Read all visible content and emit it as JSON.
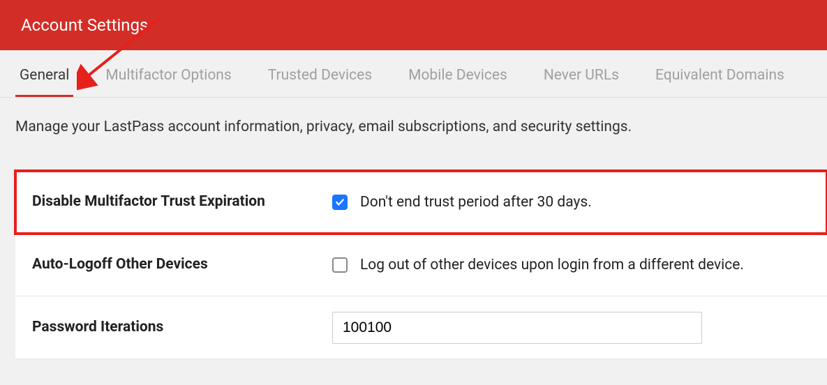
{
  "header": {
    "title": "Account Settings"
  },
  "tabs": [
    {
      "label": "General",
      "active": true
    },
    {
      "label": "Multifactor Options",
      "active": false
    },
    {
      "label": "Trusted Devices",
      "active": false
    },
    {
      "label": "Mobile Devices",
      "active": false
    },
    {
      "label": "Never URLs",
      "active": false
    },
    {
      "label": "Equivalent Domains",
      "active": false
    }
  ],
  "description": "Manage your LastPass account information, privacy, email subscriptions, and security settings.",
  "settings": {
    "multifactorTrust": {
      "label": "Disable Multifactor Trust Expiration",
      "checkboxLabel": "Don't end trust period after 30 days.",
      "checked": true,
      "highlighted": true
    },
    "autoLogoff": {
      "label": "Auto-Logoff Other Devices",
      "checkboxLabel": "Log out of other devices upon login from a different device.",
      "checked": false,
      "highlighted": false
    },
    "passwordIterations": {
      "label": "Password Iterations",
      "value": "100100"
    }
  },
  "annotation": {
    "arrowColor": "#e7201b"
  }
}
